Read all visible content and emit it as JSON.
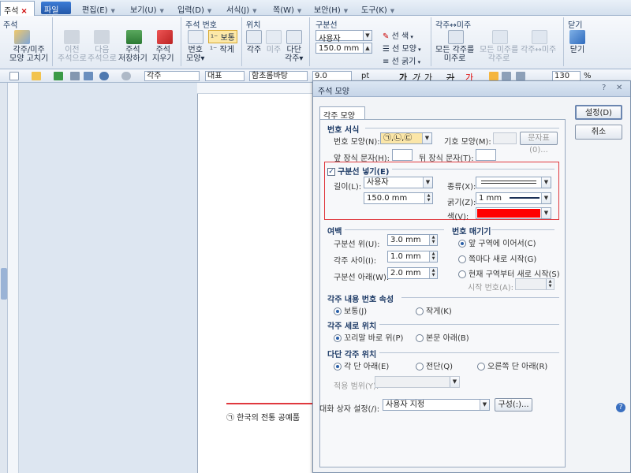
{
  "tabs": {
    "doc_tab": "주석",
    "close_glyph": "×"
  },
  "menu": {
    "file": "파일(F)",
    "items": [
      "편집(E)",
      "보기(U)",
      "입력(D)",
      "서식(J)",
      "쪽(W)",
      "보안(H)",
      "도구(K)"
    ]
  },
  "ribbon": {
    "groups": {
      "annotation": "주석",
      "annotation_number": "주석 번호",
      "position": "위치",
      "divider": "구분선",
      "swap": "각주↔미주",
      "close": "닫기"
    },
    "buttons": {
      "foot_end_shape_fix": "각주/미주\n모양 고치기",
      "prev_annotation": "이전\n주석으로",
      "next_annotation": "다음\n주석으로",
      "save_annotation": "주석\n저장하기",
      "delete_annotation": "주석\n지우기",
      "number_shape": "번호\n모양▾",
      "normal": "보통",
      "small": "작게",
      "footnote": "각주",
      "endnote": "미주",
      "multi_column": "다단\n각주▾",
      "all_to_endnote": "모든 각주를\n미주로",
      "all_to_footnote": "모든 미주를\n각주로",
      "swap_foot_end": "각주↔미주",
      "close": "닫기"
    },
    "divider_combo": "사용자",
    "divider_length": "150.0 mm",
    "line_color": "선 색",
    "line_type": "선 모양",
    "line_thickness": "선 굵기"
  },
  "toolbar": {
    "style": "각주",
    "lang": "대표",
    "font": "함초롬바탕",
    "size": "9.0",
    "unit": "pt",
    "bold": "가",
    "italic": "가",
    "underline": "가",
    "strike": "가",
    "fontcolor": "가",
    "zoom": "130",
    "percent": "%"
  },
  "document": {
    "footnote_text": "㉠ 한국의 전통 공예품"
  },
  "dialog": {
    "title": "주석 모양",
    "help_glyph": "?",
    "close_glyph": "✕",
    "tab": "각주 모양",
    "buttons": {
      "ok": "설정(D)",
      "cancel": "취소"
    },
    "number_format": {
      "section": "번호 서식",
      "shape_label": "번호 모양(N):",
      "shape_value": "㉠,㉡,㉢",
      "symbol_shape_label": "기호 모양(M):",
      "char_table_button": "문자표(0)...",
      "prefix_label": "앞 장식 문자(H):",
      "prefix_value": "",
      "suffix_label": "뒤 장식 문자(T):",
      "suffix_value": ""
    },
    "divider": {
      "checkbox_label": "구분선 넣기(E)",
      "checked": true,
      "length_label": "길이(L):",
      "length_combo": "사용자",
      "length_value": "150.0 mm",
      "type_label": "종류(X):",
      "thickness_label": "굵기(Z):",
      "thickness_value": "1 mm",
      "color_label": "색(V):",
      "color_value": "#ff0000"
    },
    "margin": {
      "section": "여백",
      "above_label": "구분선 위(U):",
      "above_value": "3.0 mm",
      "gap_label": "각주 사이(I):",
      "gap_value": "1.0 mm",
      "below_label": "구분선 아래(W):",
      "below_value": "2.0 mm"
    },
    "numbering": {
      "section": "번호 매기기",
      "continue": "앞 구역에 이어서(C)",
      "per_page": "쪽마다 새로 시작(G)",
      "from_section": "현재 구역부터 새로 시작(S)",
      "start_label": "시작 번호(A):",
      "selected": "continue"
    },
    "number_attr": {
      "section": "각주 내용 번호 속성",
      "normal": "보통(J)",
      "small": "작게(K)",
      "selected": "normal"
    },
    "vertical_pos": {
      "section": "각주 세로 위치",
      "right_after": "꼬리말 바로 위(P)",
      "below_body": "본문 아래(B)",
      "selected": "right_after"
    },
    "column_pos": {
      "section": "다단 각주 위치",
      "each_column": "각 단 아래(E)",
      "full_width": "전단(Q)",
      "right_column": "오른쪽 단 아래(R)",
      "selected": "each_column",
      "apply_label": "적용 범위(Y):"
    },
    "dialog_setting_label": "대화 상자 설정(/):",
    "dialog_setting_value": "사용자 지정",
    "compose_button": "구성(:)..."
  },
  "colors": {
    "highlight_border": "#e0393e",
    "accent_red": "#ff0000"
  }
}
